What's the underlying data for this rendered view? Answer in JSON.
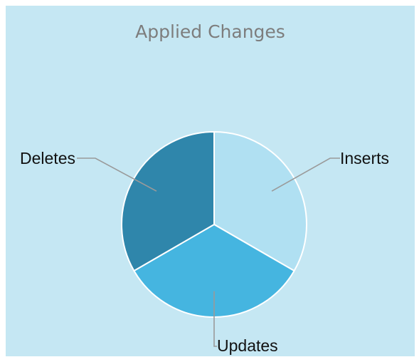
{
  "chart_data": {
    "type": "pie",
    "title": "Applied Changes",
    "slices": [
      {
        "label": "Inserts",
        "value": 33.34,
        "color": "#b0e0f2"
      },
      {
        "label": "Updates",
        "value": 33.33,
        "color": "#45b5e0"
      },
      {
        "label": "Deletes",
        "value": 33.33,
        "color": "#2f86ab"
      }
    ],
    "legend": "none",
    "labels": "outside-with-leader-lines"
  }
}
